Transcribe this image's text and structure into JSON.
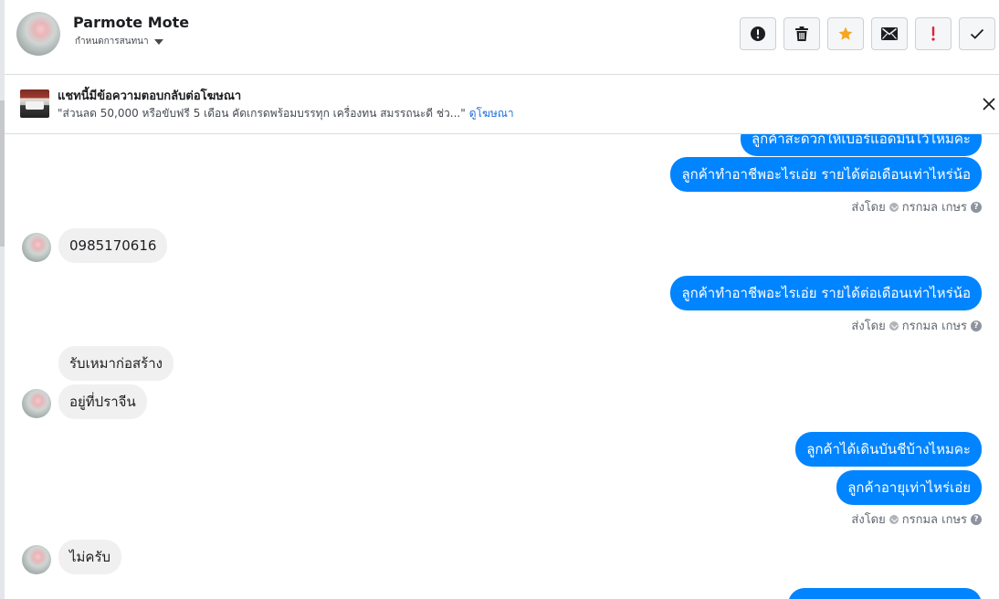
{
  "header": {
    "contact_name": "Parmote Mote",
    "assign_label": "กำหนดการสนทนา",
    "toolbar": [
      {
        "name": "spam-button",
        "icon": "alert-circle-icon"
      },
      {
        "name": "delete-button",
        "icon": "trash-icon"
      },
      {
        "name": "star-button",
        "icon": "star-icon"
      },
      {
        "name": "mark-unread-button",
        "icon": "envelope-icon"
      },
      {
        "name": "follow-up-button",
        "icon": "exclamation-icon"
      },
      {
        "name": "mark-done-button",
        "icon": "check-icon"
      }
    ]
  },
  "banner": {
    "title": "แชทนี้มีข้อความตอบกลับต่อโฆษณา",
    "quote": "\"ส่วนลด 50,000 หรือขับฟรี 5 เดือน คัดเกรดพร้อมบรรทุก เครื่องทน สมรรถนะดี ช่ว...\"",
    "link": "ดูโฆษณา"
  },
  "conversation": {
    "sent_by_label": "ส่งโดย",
    "sender_name": "กรกมล เกษร",
    "messages": {
      "m0": "ลูกค้าสะดวกให้เบอร์แอดมินไว้ไหมคะ",
      "m1": "ลูกค้าทำอาชีพอะไรเอ่ย รายได้ต่อเดือนเท่าไหร่น้อ",
      "m2": "0985170616",
      "m3": "ลูกค้าทำอาชีพอะไรเอ่ย รายได้ต่อเดือนเท่าไหร่น้อ",
      "m4": "รับเหมาก่อสร้าง",
      "m5": "อยู่ที่ปราจีน",
      "m6": "ลูกค้าได้เดินบันชีบ้างไหมคะ",
      "m7": "ลูกค้าอายุเท่าไหร่เอ่ย",
      "m8": "ไม่ครับ"
    }
  },
  "colors": {
    "outgoing_bubble": "#0084ff",
    "incoming_bubble": "#f1f0f0",
    "star": "#f5a623",
    "follow_up": "#e41e3f",
    "link": "#216fdb"
  }
}
